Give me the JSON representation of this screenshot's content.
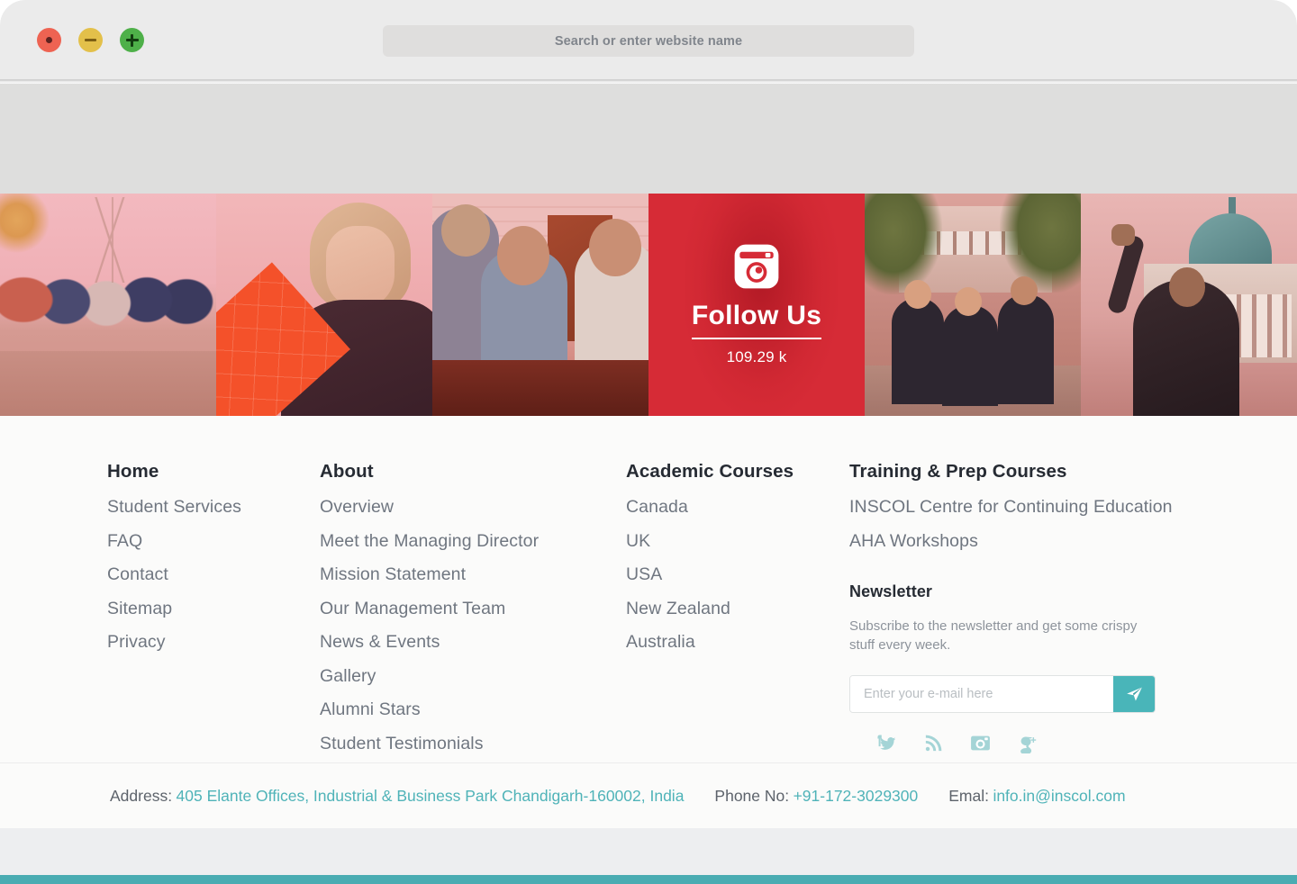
{
  "browser": {
    "traffic_lights": [
      {
        "name": "close",
        "color": "#ee6352",
        "glyph": "dot"
      },
      {
        "name": "minimize",
        "color": "#e3c04a",
        "glyph": "minus"
      },
      {
        "name": "maximize",
        "color": "#4eb049",
        "glyph": "plus"
      }
    ],
    "omnibox": {
      "placeholder": "Search or enter website name",
      "value": ""
    }
  },
  "photo_strip": {
    "panels": [
      {
        "id": "panel-students-on-wall",
        "caption": ""
      },
      {
        "id": "panel-woman-with-folder",
        "caption": ""
      },
      {
        "id": "panel-students-at-table",
        "caption": ""
      },
      {
        "id": "panel-follow-us",
        "caption": "Follow Us"
      },
      {
        "id": "panel-festival-group",
        "caption": ""
      },
      {
        "id": "panel-graduate",
        "caption": ""
      }
    ],
    "follow": {
      "icon": "instagram-icon",
      "title": "Follow Us",
      "count": "109.29 k",
      "background_color": "#d62b36"
    }
  },
  "footer": {
    "columns": [
      {
        "heading": "Home",
        "links": [
          "Student Services",
          "FAQ",
          "Contact",
          "Sitemap",
          "Privacy"
        ]
      },
      {
        "heading": "About",
        "links": [
          "Overview",
          "Meet the Managing Director",
          "Mission Statement",
          "Our Management Team",
          "News & Events",
          "Gallery",
          "Alumni Stars",
          "Student Testimonials"
        ]
      },
      {
        "heading": "Academic Courses",
        "links": [
          "Canada",
          "UK",
          "USA",
          "New Zealand",
          "Australia"
        ]
      },
      {
        "heading": "Training & Prep Courses",
        "links": [
          "INSCOL Centre for Continuing Education",
          "AHA Workshops"
        ]
      }
    ],
    "newsletter": {
      "heading": "Newsletter",
      "description": "Subscribe to the newsletter and get some crispy stuff every week.",
      "input_placeholder": "Enter your e-mail here",
      "input_value": "",
      "submit_icon": "paper-plane-icon",
      "submit_color": "#49b5b9"
    },
    "socials": [
      {
        "name": "facebook-twitter-icon",
        "label": "Facebook / Twitter"
      },
      {
        "name": "rss-icon",
        "label": "RSS"
      },
      {
        "name": "instagram-icon",
        "label": "Instagram"
      },
      {
        "name": "google-plus-icon",
        "label": "Google Plus"
      }
    ]
  },
  "contact": {
    "address_label": "Address:",
    "address_value": "405 Elante Offices, Industrial & Business Park Chandigarh-160002, India",
    "phone_label": "Phone No:",
    "phone_value": "+91-172-3029300",
    "email_label": "Emal:",
    "email_value": "info.in@inscol.com"
  },
  "theme": {
    "accent_teal": "#4fb3b8",
    "accent_red": "#d62b36",
    "text_dark": "#262b33",
    "text_muted": "#6f7680"
  }
}
